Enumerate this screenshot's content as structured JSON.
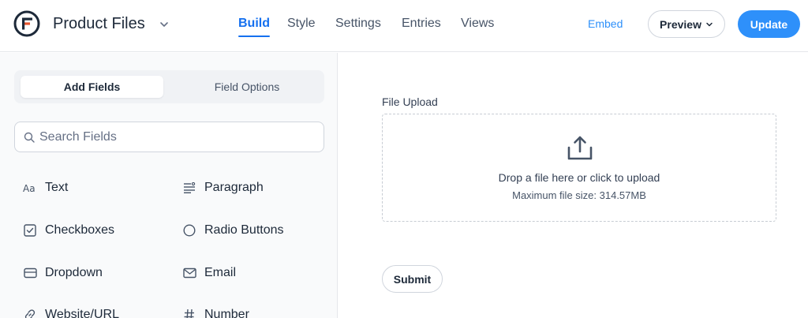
{
  "header": {
    "form_title": "Product Files",
    "nav": [
      {
        "label": "Build",
        "active": true
      },
      {
        "label": "Style",
        "active": false
      },
      {
        "label": "Settings",
        "active": false
      },
      {
        "label": "Entries",
        "active": false
      },
      {
        "label": "Views",
        "active": false
      }
    ],
    "embed_label": "Embed",
    "preview_label": "Preview",
    "update_label": "Update"
  },
  "sidebar": {
    "tabs": [
      {
        "label": "Add Fields",
        "active": true
      },
      {
        "label": "Field Options",
        "active": false
      }
    ],
    "search": {
      "placeholder": "Search Fields",
      "value": ""
    },
    "fields": [
      {
        "label": "Text",
        "icon": "text-aa-icon"
      },
      {
        "label": "Paragraph",
        "icon": "paragraph-icon"
      },
      {
        "label": "Checkboxes",
        "icon": "checkbox-icon"
      },
      {
        "label": "Radio Buttons",
        "icon": "radio-icon"
      },
      {
        "label": "Dropdown",
        "icon": "dropdown-icon"
      },
      {
        "label": "Email",
        "icon": "email-icon"
      },
      {
        "label": "Website/URL",
        "icon": "link-icon"
      },
      {
        "label": "Number",
        "icon": "hash-icon"
      }
    ]
  },
  "canvas": {
    "upload_label": "File Upload",
    "drop_text": "Drop a file here or click to upload",
    "max_size": "Maximum file size: 314.57MB",
    "submit_label": "Submit"
  },
  "colors": {
    "accent": "#2e90fa",
    "nav_active": "#1570ef",
    "logo_red": "#e8552e",
    "text_dark": "#1d2939"
  }
}
